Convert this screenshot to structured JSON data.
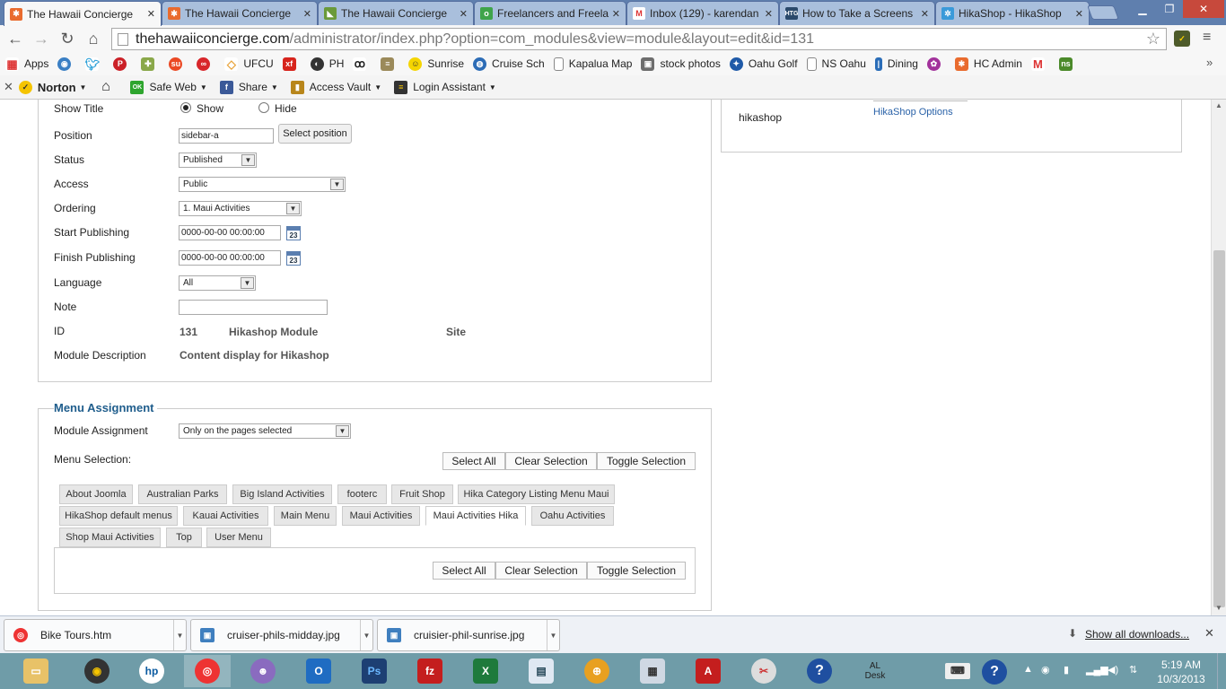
{
  "browser": {
    "tabs": [
      {
        "label": "The Hawaii Concierge",
        "active": true,
        "icon": "joomla-icon"
      },
      {
        "label": "The Hawaii Concierge",
        "active": false,
        "icon": "joomla-icon"
      },
      {
        "label": "The Hawaii Concierge",
        "active": false,
        "icon": "leaf-icon"
      },
      {
        "label": "Freelancers and Freela",
        "active": false,
        "icon": "odesk-icon"
      },
      {
        "label": "Inbox (129) - karendan",
        "active": false,
        "icon": "gmail-icon"
      },
      {
        "label": "How to Take a Screens",
        "active": false,
        "icon": "htg-icon"
      },
      {
        "label": "HikaShop - HikaShop",
        "active": false,
        "icon": "hikashop-icon"
      }
    ],
    "url_host": "thehawaiiconcierge.com",
    "url_path": "/administrator/index.php?option=com_modules&view=module&layout=edit&id=131"
  },
  "bookmarks": [
    {
      "label": "Apps",
      "icon": "apps-icon"
    },
    {
      "label": "",
      "icon": "globe-icon"
    },
    {
      "label": "",
      "icon": "twitter-icon"
    },
    {
      "label": "",
      "icon": "pinterest-icon"
    },
    {
      "label": "",
      "icon": "puzzle-icon"
    },
    {
      "label": "",
      "icon": "stumbleupon-icon"
    },
    {
      "label": "",
      "icon": "link-icon"
    },
    {
      "label": "UFCU",
      "icon": "diamond-icon"
    },
    {
      "label": "",
      "icon": "xf-icon"
    },
    {
      "label": "PH",
      "icon": "ph-icon"
    },
    {
      "label": "",
      "icon": "owl-icon"
    },
    {
      "label": "",
      "icon": "chart-icon"
    },
    {
      "label": "Sunrise",
      "icon": "smiley-icon"
    },
    {
      "label": "Cruise Sch",
      "icon": "globe-blue-icon"
    },
    {
      "label": "Kapalua Map",
      "icon": "page-icon"
    },
    {
      "label": "stock photos",
      "icon": "camera-icon"
    },
    {
      "label": "Oahu Golf",
      "icon": "golf-icon"
    },
    {
      "label": "NS Oahu",
      "icon": "page-icon"
    },
    {
      "label": "Dining",
      "icon": "dining-icon"
    },
    {
      "label": "",
      "icon": "flower-icon"
    },
    {
      "label": "HC Admin",
      "icon": "joomla-icon"
    },
    {
      "label": "",
      "icon": "gmail-icon"
    },
    {
      "label": "",
      "icon": "ns-icon"
    }
  ],
  "norton": {
    "brand": "Norton",
    "safe_web": "Safe Web",
    "share": "Share",
    "access_vault": "Access Vault",
    "login_assistant": "Login Assistant"
  },
  "module_form": {
    "show_title_label": "Show Title",
    "show_option": "Show",
    "hide_option": "Hide",
    "show_title_value": "Show",
    "position_label": "Position",
    "position_value": "sidebar-a",
    "select_position": "Select position",
    "status_label": "Status",
    "status_value": "Published",
    "access_label": "Access",
    "access_value": "Public",
    "ordering_label": "Ordering",
    "ordering_value": "1. Maui Activities",
    "start_label": "Start Publishing",
    "start_value": "0000-00-00 00:00:00",
    "finish_label": "Finish Publishing",
    "finish_value": "0000-00-00 00:00:00",
    "calendar_text": "23",
    "language_label": "Language",
    "language_value": "All",
    "note_label": "Note",
    "note_value": "",
    "id_label": "ID",
    "id_value": "131",
    "module_type": "Hikashop Module",
    "client": "Site",
    "description_label": "Module Description",
    "description_value": "Content display for Hikashop"
  },
  "side_panel": {
    "name": "hikashop",
    "options_link": "HikaShop Options"
  },
  "menu_assignment": {
    "heading": "Menu Assignment",
    "module_assignment_label": "Module Assignment",
    "module_assignment_value": "Only on the pages selected",
    "menu_selection_label": "Menu Selection:",
    "select_all": "Select All",
    "clear_selection": "Clear Selection",
    "toggle_selection": "Toggle Selection",
    "menu_tabs": [
      "About Joomla",
      "Australian Parks",
      "Big Island Activities",
      "footerc",
      "Fruit Shop",
      "Hika Category Listing Menu Maui",
      "HikaShop default menus",
      "Kauai Activities",
      "Main Menu",
      "Maui Activities",
      "Maui Activities Hika",
      "Oahu Activities",
      "Shop Maui Activities",
      "Top",
      "User Menu"
    ],
    "active_tab": "Maui Activities Hika"
  },
  "downloads": {
    "items": [
      {
        "name": "Bike Tours.htm",
        "icon": "chrome-icon"
      },
      {
        "name": "cruiser-phils-midday.jpg",
        "icon": "image-file-icon"
      },
      {
        "name": "cruisier-phil-sunrise.jpg",
        "icon": "image-file-icon"
      }
    ],
    "show_all": "Show all downloads..."
  },
  "taskbar": {
    "time": "5:19 AM",
    "date": "10/3/2013",
    "desk_label": "AL Desk"
  },
  "colors": {
    "heading_blue": "#1f5d8c",
    "link_blue": "#2a62a8",
    "taskbar": "#6f9ca8",
    "tabstrip": "#5f7fae"
  }
}
